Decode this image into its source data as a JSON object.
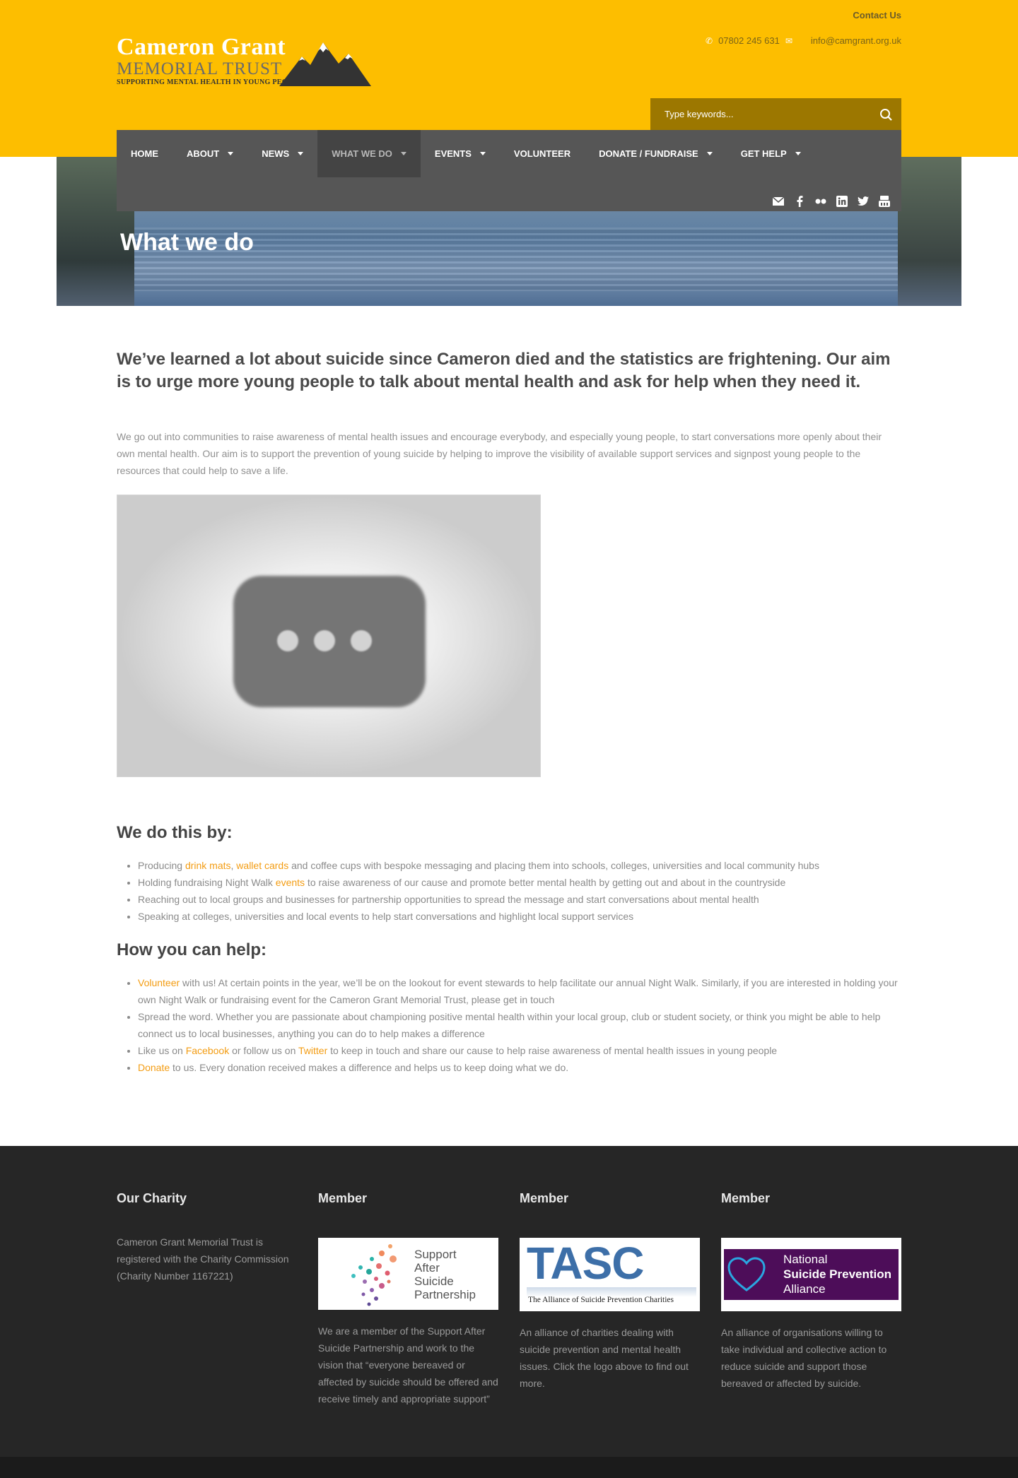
{
  "header": {
    "contact_link": "Contact Us",
    "phone": "07802 245 631",
    "email": "info@camgrant.org.uk",
    "logo_line1": "Cameron Grant",
    "logo_line2": "MEMORIAL TRUST",
    "logo_line3": "SUPPORTING MENTAL HEALTH IN YOUNG PEOPLE",
    "search_placeholder": "Type keywords..."
  },
  "nav": {
    "items": [
      {
        "label": "HOME"
      },
      {
        "label": "ABOUT"
      },
      {
        "label": "NEWS"
      },
      {
        "label": "WHAT WE DO"
      },
      {
        "label": "EVENTS"
      },
      {
        "label": "VOLUNTEER"
      },
      {
        "label": "DONATE / FUNDRAISE"
      },
      {
        "label": "GET HELP"
      }
    ],
    "social": [
      "email-icon",
      "facebook-icon",
      "flickr-icon",
      "linkedin-icon",
      "twitter-icon",
      "youtube-icon"
    ]
  },
  "hero": {
    "title": "What we do"
  },
  "main": {
    "lead": "We’ve learned a lot about suicide since Cameron died and the statistics are frightening. Our aim is to urge more young people to talk about mental health and ask for help when they need it.",
    "intro": "We go out into communities to raise awareness of mental health issues and encourage everybody, and especially young people, to start conversations more openly about their own mental health. Our aim is to support the prevention of young suicide by helping to improve the visibility of available support services and signpost young people to the resources that could help to save a life.",
    "we_do_heading": "We do this by:",
    "we_do": {
      "i1_a": "Producing ",
      "i1_link1": "drink mats",
      "i1_b": ", ",
      "i1_link2": "wallet cards",
      "i1_c": " and coffee cups with bespoke messaging and placing them into schools, colleges, universities and local community hubs",
      "i2_a": "Holding fundraising Night Walk ",
      "i2_link": "events",
      "i2_b": " to raise awareness of our cause and promote better mental health by getting out and about in the countryside",
      "i3": "Reaching out to local groups and businesses for partnership opportunities to spread the message and start conversations about mental health",
      "i4": "Speaking at colleges, universities and local events to help start conversations and highlight local support services"
    },
    "help_heading": "How you can help:",
    "help": {
      "i1_link": "Volunteer",
      "i1_b": " with us! At certain points in the year, we’ll be on the lookout for event stewards to help facilitate our annual Night Walk. Similarly, if you are interested in holding your own Night Walk or fundraising event for the Cameron Grant Memorial Trust, please get in touch",
      "i2": "Spread the word. Whether you are passionate about championing positive mental health within your local group, club or student society, or think you might be able to help connect us to local businesses, anything you can do to help makes a difference",
      "i3_a": "Like us on ",
      "i3_link1": "Facebook",
      "i3_b": " or follow us on ",
      "i3_link2": "Twitter",
      "i3_c": " to keep in touch and share our cause to help raise awareness of mental health issues in young people",
      "i4_link": "Donate",
      "i4_b": " to us. Every donation received makes a difference and helps us to keep doing what we do."
    }
  },
  "footer": {
    "col1": {
      "title": "Our Charity",
      "text": "Cameron Grant Memorial Trust is registered with the Charity Commission (Charity Number 1167221)"
    },
    "col2": {
      "title": "Member",
      "logo_l1": "Support",
      "logo_l2": "After",
      "logo_l3": "Suicide",
      "logo_l4": "Partnership",
      "text": "We are a member of the Support After Suicide Partnership and work to the vision that “everyone bereaved or affected by suicide should be offered and receive timely and appropriate support”"
    },
    "col3": {
      "title": "Member",
      "logo_big": "TASC",
      "logo_small": "The Alliance of Suicide Prevention Charities",
      "text": "An alliance of charities dealing with suicide prevention and mental health issues. Click the logo above to find out more."
    },
    "col4": {
      "title": "Member",
      "logo_l1": "National",
      "logo_l2": "Suicide Prevention",
      "logo_l3": "Alliance",
      "text": "An alliance of organisations willing to take individual and collective action to reduce suicide and support those bereaved or affected by suicide."
    }
  },
  "colors": {
    "brand_yellow": "#fdbe00",
    "nav_gray": "#565656",
    "link_orange": "#f39c12",
    "footer_dark": "#262626",
    "nspa_purple": "#4d0d59"
  }
}
